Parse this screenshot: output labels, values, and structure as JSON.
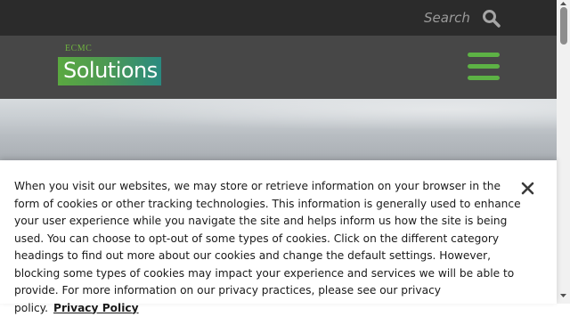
{
  "header": {
    "search_label": "Search",
    "search_icon": "search-icon"
  },
  "nav": {
    "logo_small_text": "ECMC",
    "logo_main_text": "Solutions",
    "menu_icon": "hamburger-menu-icon",
    "accent_color": "#5db245"
  },
  "cookie_banner": {
    "message": "When you visit our websites, we may store or retrieve information on your browser in the form of cookies or other tracking technologies. This information is generally used to enhance your user experience while you navigate the site and helps inform us how the site is being used. You can choose to opt-out of some types of cookies. Click on the different category headings to find out more about our cookies and change the default settings. However, blocking some types of cookies may impact your experience and services we will be able to provide. For more information on our privacy practices, please see our privacy policy.",
    "privacy_link_label": "Privacy Policy",
    "close_icon": "close-icon"
  }
}
